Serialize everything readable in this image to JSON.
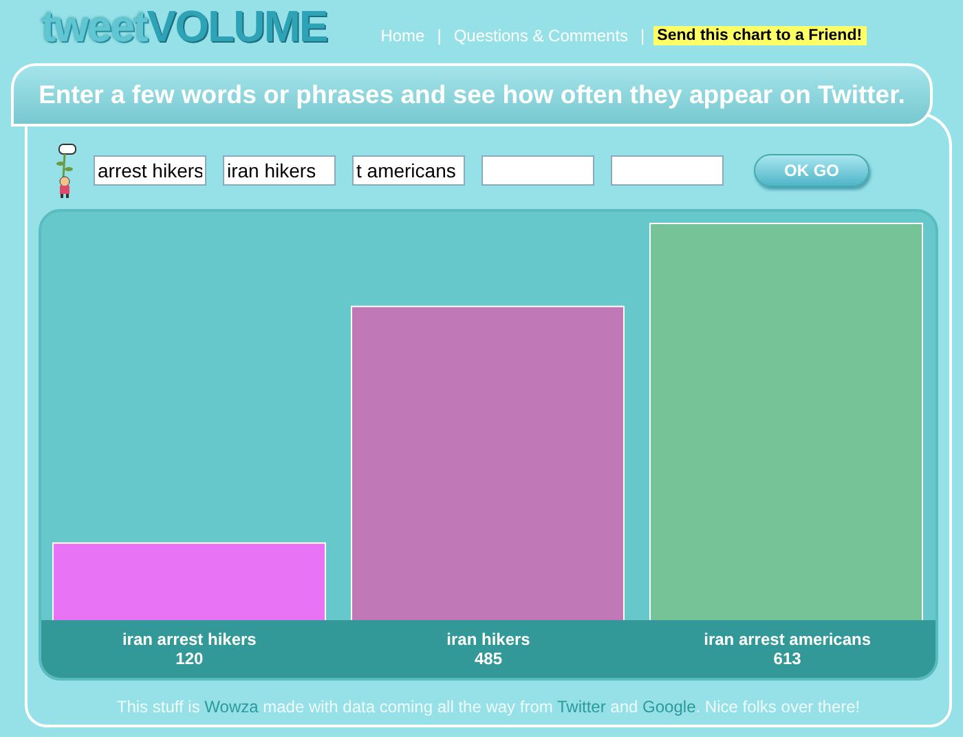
{
  "logo": {
    "light": "tweet",
    "bold": "VOLUME"
  },
  "nav": {
    "separator": "|",
    "links": [
      {
        "label": "Home",
        "highlighted": false
      },
      {
        "label": "Questions & Comments",
        "highlighted": false
      },
      {
        "label": "Send this chart to a Friend!",
        "highlighted": true
      }
    ]
  },
  "banner": "Enter a few words or phrases and see how often they appear on Twitter.",
  "inputs": [
    {
      "value": "arrest hikers"
    },
    {
      "value": "iran hikers"
    },
    {
      "value": "t americans"
    },
    {
      "filled": false
    },
    {
      "filled": false
    }
  ],
  "go_button": "OK GO",
  "chart": {
    "bars": [
      {
        "color": "#e873f5"
      },
      {
        "color": "#c078b7"
      },
      {
        "color": "#76c397"
      }
    ],
    "chart_data": {
      "type": "bar",
      "categories": [
        "iran arrest hikers",
        "iran hikers",
        "iran arrest americans"
      ],
      "data_labels": true,
      "values": [
        120,
        485,
        613
      ]
    }
  },
  "footer": [
    {
      "kind": "plain",
      "text": "This stuff is "
    },
    {
      "kind": "link",
      "text": "Wowza"
    },
    {
      "kind": "plain",
      "text": " made with data coming all the way from "
    },
    {
      "kind": "link",
      "text": "Twitter"
    },
    {
      "kind": "plain",
      "text": " and "
    },
    {
      "kind": "link",
      "text": "Google"
    },
    {
      "kind": "plain",
      "text": ". Nice folks over there!"
    }
  ]
}
